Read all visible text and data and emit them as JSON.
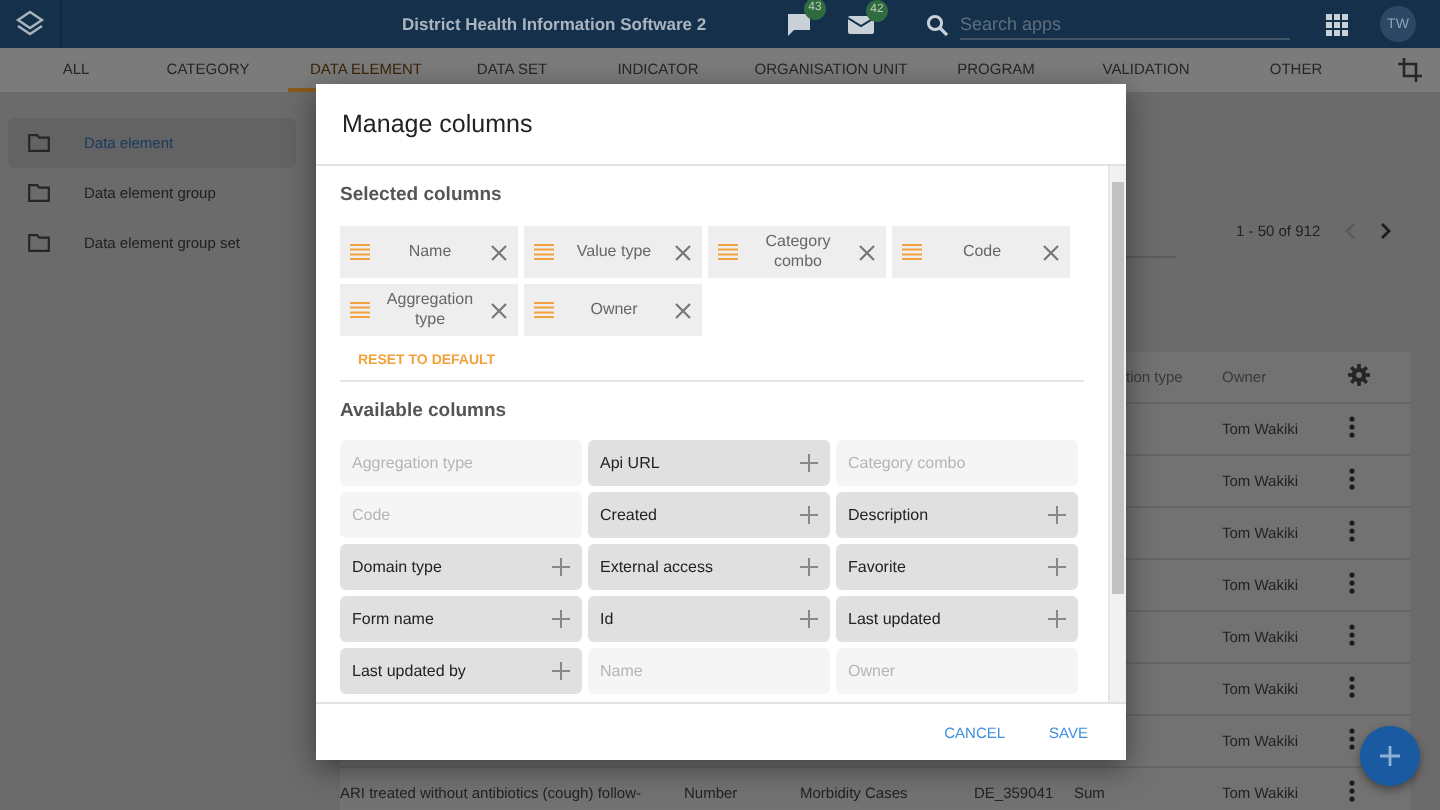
{
  "header": {
    "title": "District Health Information Software 2",
    "messages_badge": "43",
    "mail_badge": "42",
    "search": {
      "placeholder": "Search apps"
    },
    "avatar": "TW"
  },
  "tabs": [
    {
      "label": "ALL",
      "selected": false
    },
    {
      "label": "CATEGORY",
      "selected": false
    },
    {
      "label": "DATA ELEMENT",
      "selected": true
    },
    {
      "label": "DATA SET",
      "selected": false
    },
    {
      "label": "INDICATOR",
      "selected": false
    },
    {
      "label": "ORGANISATION UNIT",
      "selected": false
    },
    {
      "label": "PROGRAM",
      "selected": false
    },
    {
      "label": "VALIDATION",
      "selected": false
    },
    {
      "label": "OTHER",
      "selected": false
    }
  ],
  "sidebar": {
    "items": [
      {
        "label": "Data element",
        "selected": true
      },
      {
        "label": "Data element group",
        "selected": false
      },
      {
        "label": "Data element group set",
        "selected": false
      }
    ]
  },
  "pagination": {
    "range": "1 - 50 of 912"
  },
  "table": {
    "columns": [
      "tion type",
      "Owner"
    ],
    "rows": [
      {
        "owner": "Tom Wakiki"
      },
      {
        "owner": "Tom Wakiki"
      },
      {
        "owner": "Tom Wakiki"
      },
      {
        "owner": "Tom Wakiki"
      },
      {
        "owner": "Tom Wakiki"
      },
      {
        "owner": "Tom Wakiki"
      },
      {
        "owner": "Tom Wakiki"
      },
      {
        "name": "ARI treated without antibiotics (cough) follow-",
        "value_type": "Number",
        "domain": "Morbidity Cases",
        "code": "DE_359041",
        "aggregation": "Sum",
        "owner": "Tom Wakiki"
      }
    ]
  },
  "dialog": {
    "title": "Manage columns",
    "selected_heading": "Selected columns",
    "selected_columns": [
      "Name",
      "Value type",
      "Category combo",
      "Code",
      "Aggregation type",
      "Owner"
    ],
    "reset": "RESET TO DEFAULT",
    "available_heading": "Available columns",
    "available_columns": [
      {
        "label": "Aggregation type",
        "disabled": true
      },
      {
        "label": "Api URL",
        "disabled": false
      },
      {
        "label": "Category combo",
        "disabled": true
      },
      {
        "label": "Code",
        "disabled": true
      },
      {
        "label": "Created",
        "disabled": false
      },
      {
        "label": "Description",
        "disabled": false
      },
      {
        "label": "Domain type",
        "disabled": false
      },
      {
        "label": "External access",
        "disabled": false
      },
      {
        "label": "Favorite",
        "disabled": false
      },
      {
        "label": "Form name",
        "disabled": false
      },
      {
        "label": "Id",
        "disabled": false
      },
      {
        "label": "Last updated",
        "disabled": false
      },
      {
        "label": "Last updated by",
        "disabled": false
      },
      {
        "label": "Name",
        "disabled": true
      },
      {
        "label": "Owner",
        "disabled": true
      }
    ],
    "buttons": [
      "CANCEL",
      "SAVE"
    ]
  }
}
